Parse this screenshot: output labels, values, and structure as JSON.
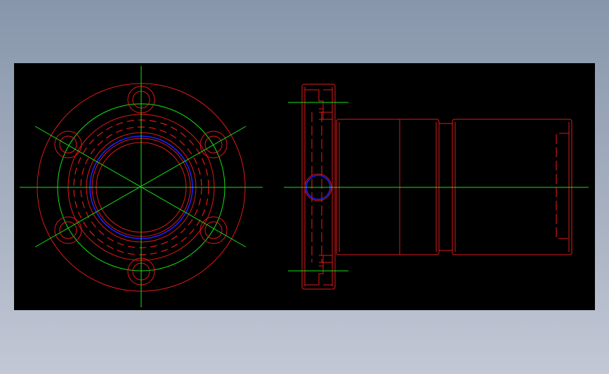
{
  "drawing": {
    "background": "#000000",
    "colors": {
      "outline": "#e01818",
      "centerline": "#18e018",
      "thread": "#2020ff"
    },
    "views": [
      "front-view",
      "side-view"
    ]
  }
}
